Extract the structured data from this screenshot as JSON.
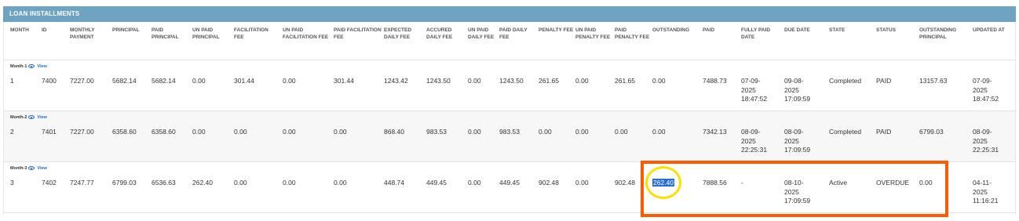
{
  "panel": {
    "title": "LOAN INSTALLMENTS"
  },
  "columns": [
    "MONTH",
    "ID",
    "MONTHLY PAYMENT",
    "PRINCIPAL",
    "PAID PRINCIPAL",
    "UN PAID PRINCIPAL",
    "FACILITATION FEE",
    "UN PAID FACILITATION FEE",
    "PAID FACILITATION FEE",
    "EXPECTED DAILY FEE",
    "ACCURED DAILY FEE",
    "UN PAID DAILY FEE",
    "PAID DAILY FEE",
    "PENALTY FEE",
    "UN PAID PENALTY FEE",
    "PAID PENALTY FEE",
    "OUTSTANDING",
    "PAID",
    "FULLY PAID DATE",
    "DUE DATE",
    "STATE",
    "STATUS",
    "OUTSTANDING PRINCIPAL",
    "UPDATED AT"
  ],
  "view_label": "View",
  "rows": [
    {
      "month_label": "Month-1",
      "cells": [
        "1",
        "7400",
        "7227.00",
        "5682.14",
        "5682.14",
        "0.00",
        "301.44",
        "0.00",
        "301.44",
        "1243.42",
        "1243.50",
        "0.00",
        "1243.50",
        "261.65",
        "0.00",
        "261.65",
        "0.00",
        "7488.73",
        "07-09-\n2025\n18:47:52",
        "09-08-\n2025\n17:09:59",
        "Completed",
        "PAID",
        "13157.63",
        "07-09-\n2025\n18:47:52"
      ]
    },
    {
      "month_label": "Month-2",
      "cells": [
        "2",
        "7401",
        "7227.00",
        "6358.60",
        "6358.60",
        "0.00",
        "0.00",
        "0.00",
        "0.00",
        "868.40",
        "983.53",
        "0.00",
        "983.53",
        "0.00",
        "0.00",
        "0.00",
        "0.00",
        "7342.13",
        "08-09-\n2025\n22:25:31",
        "08-09-\n2025\n17:09:59",
        "Completed",
        "PAID",
        "6799.03",
        "08-09-\n2025\n22:25:31"
      ]
    },
    {
      "month_label": "Month-3",
      "cells": [
        "3",
        "7402",
        "7247.77",
        "6799.03",
        "6536.63",
        "262.40",
        "0.00",
        "0.00",
        "0.00",
        "448.74",
        "449.45",
        "0.00",
        "449.45",
        "902.48",
        "0.00",
        "902.48",
        "262.40",
        "7888.56",
        "-",
        "08-10-\n2025\n17:09:59",
        "Active",
        "OVERDUE",
        "0.00",
        "04-11-\n2025\n11:16:21"
      ]
    }
  ],
  "highlight": {
    "selection_color": "#2a6ed1",
    "box_color": "#ff5a00",
    "circle_color": "#ffdf00"
  }
}
